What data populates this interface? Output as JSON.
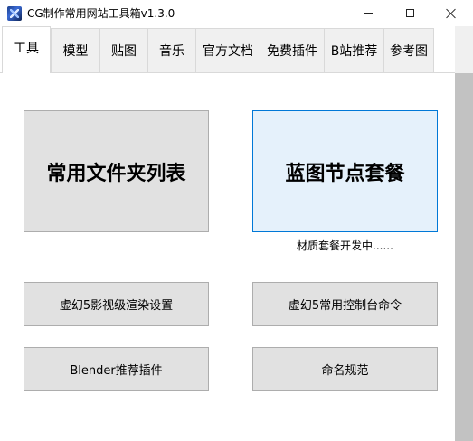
{
  "window": {
    "title": "CG制作常用网站工具箱v1.3.0"
  },
  "tabs": [
    {
      "label": "工具",
      "active": true
    },
    {
      "label": "模型",
      "active": false
    },
    {
      "label": "贴图",
      "active": false
    },
    {
      "label": "音乐",
      "active": false
    },
    {
      "label": "官方文档",
      "active": false
    },
    {
      "label": "免费插件",
      "active": false
    },
    {
      "label": "B站推荐",
      "active": false
    },
    {
      "label": "参考图",
      "active": false
    }
  ],
  "main": {
    "common_folders_label": "常用文件夹列表",
    "blueprint_nodes_label": "蓝图节点套餐",
    "blueprint_status": "材质套餐开发中......",
    "ue5_render_settings_label": "虚幻5影视级渲染设置",
    "ue5_console_commands_label": "虚幻5常用控制台命令",
    "blender_plugins_label": "Blender推荐插件",
    "naming_rules_label": "命名规范"
  },
  "colors": {
    "button_face": "#e1e1e1",
    "button_border": "#adadad",
    "hover_face": "#e5f1fb",
    "hover_border": "#0078d7",
    "tab_inactive": "#f0f0f0",
    "scroll_thumb": "#c2c2c2"
  }
}
